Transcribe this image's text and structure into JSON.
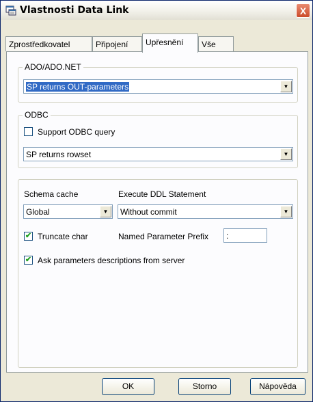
{
  "window": {
    "title": "Vlastnosti Data Link",
    "close_label": "X"
  },
  "tabs": [
    {
      "label": "Zprostředkovatel"
    },
    {
      "label": "Připojení"
    },
    {
      "label": "Upřesnění"
    },
    {
      "label": "Vše"
    }
  ],
  "active_tab": "Upřesnění",
  "ado": {
    "group_label": "ADO/ADO.NET",
    "select_value": "SP returns OUT-parameters"
  },
  "odbc": {
    "group_label": "ODBC",
    "support_query_label": "Support ODBC query",
    "support_query_checked": false,
    "select_value": "SP returns rowset"
  },
  "options": {
    "schema_cache_label": "Schema cache",
    "schema_cache_value": "Global",
    "execute_ddl_label": "Execute DDL Statement",
    "execute_ddl_value": "Without commit",
    "truncate_char_label": "Truncate char",
    "truncate_char_checked": true,
    "named_param_prefix_label": "Named Parameter Prefix",
    "named_param_prefix_value": ":",
    "ask_params_label": "Ask parameters descriptions from server",
    "ask_params_checked": true
  },
  "buttons": {
    "ok": "OK",
    "cancel": "Storno",
    "help": "Nápověda"
  },
  "icons": {
    "title_icon": "data-link-icon",
    "dropdown_arrow": "▼",
    "check": "✔"
  }
}
